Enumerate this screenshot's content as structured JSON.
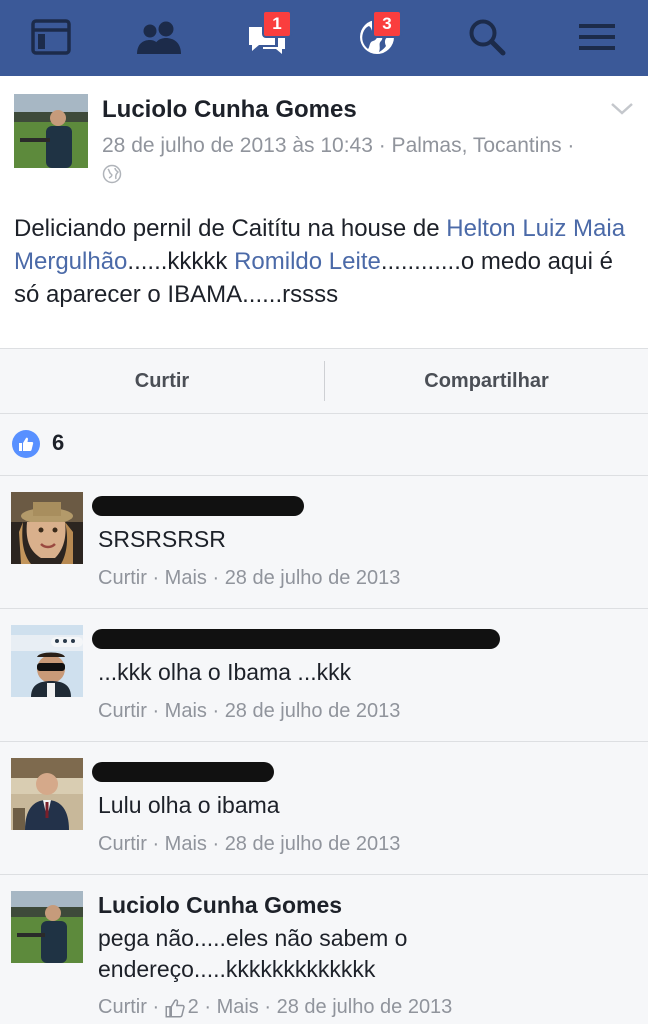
{
  "nav": {
    "items": [
      {
        "icon": "news-feed-icon"
      },
      {
        "icon": "friends-icon"
      },
      {
        "icon": "messages-icon",
        "badge": "1"
      },
      {
        "icon": "notifications-globe-icon",
        "badge": "3"
      },
      {
        "icon": "search-icon"
      },
      {
        "icon": "menu-icon"
      }
    ],
    "color": "#3b5998"
  },
  "post": {
    "author": "Luciolo Cunha Gomes",
    "meta": "28 de julho de 2013 às 10:43 · Palmas, Tocantins ·",
    "text_1": "Deliciando pernil de Caitítu na house de ",
    "mention_1": "Helton Luiz Maia Mergulhão",
    "text_2": "......kkkkk ",
    "mention_2": "Romildo Leite",
    "text_3": "............o medo aqui é só aparecer o IBAMA......rssss",
    "link_color": "#4b6aa8"
  },
  "actions": {
    "like": "Curtir",
    "share": "Compartilhar"
  },
  "likes": {
    "count": "6"
  },
  "comments": [
    {
      "text": "SRSRSRSR",
      "like": "Curtir",
      "more": "Mais",
      "date": "28 de julho de 2013"
    },
    {
      "text": "...kkk olha o Ibama ...kkk",
      "like": "Curtir",
      "more": "Mais",
      "date": "28 de julho de 2013"
    },
    {
      "text": "Lulu olha o ibama",
      "like": "Curtir",
      "more": "Mais",
      "date": "28 de julho de 2013"
    },
    {
      "name": "Luciolo Cunha Gomes",
      "text": "pega não.....eles não sabem o endereço.....kkkkkkkkkkkkk",
      "like": "Curtir",
      "reactions": "2",
      "more": "Mais",
      "date": "28 de julho de 2013"
    }
  ]
}
